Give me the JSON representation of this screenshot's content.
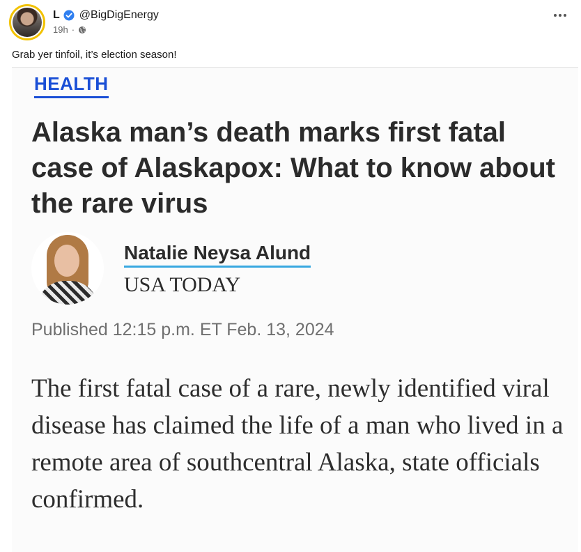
{
  "post": {
    "author_name": "L",
    "author_handle": "@BigDigEnergy",
    "time": "19h",
    "separator": "·",
    "text": "Grab yer tinfoil, it’s election season!",
    "icons": {
      "avatar": "avatar",
      "verified": "verified-icon",
      "visibility": "globe-icon",
      "more": "more-icon"
    }
  },
  "article": {
    "section": "HEALTH",
    "headline": "Alaska man’s death marks first fatal case of Alaskapox: What to know about the rare virus",
    "author": "Natalie Neysa Alund",
    "publication": "USA TODAY",
    "published": "Published 12:15 p.m. ET Feb. 13, 2024",
    "body": "The first fatal case of a rare, newly identified viral disease has claimed the life of a man who lived in a remote area of southcentral Alaska, state officials confirmed.",
    "colors": {
      "section": "#1a4fd6",
      "author_underline": "#38a8e0",
      "verified": "#2f7ff0"
    }
  }
}
